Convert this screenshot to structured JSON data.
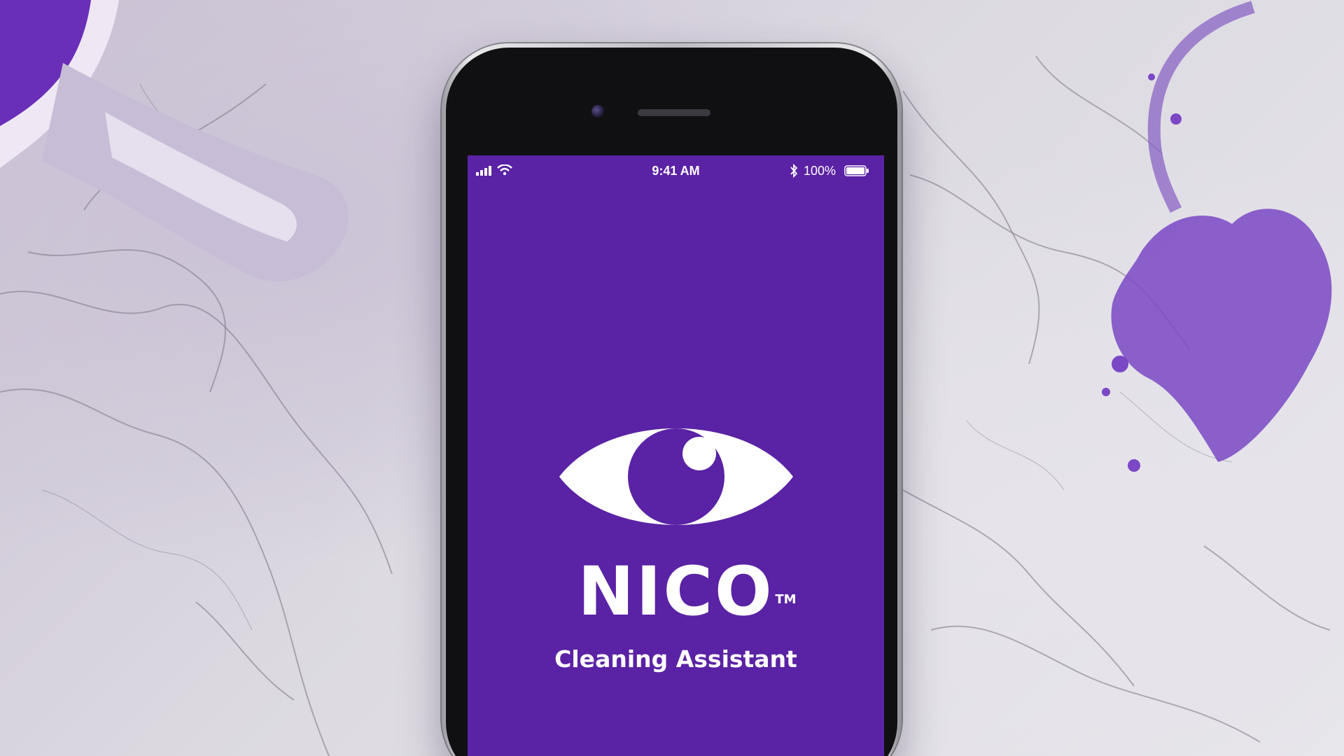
{
  "status_bar": {
    "time": "9:41 AM",
    "battery_percent": "100%",
    "signal_icon": "signal-bars-icon",
    "wifi_icon": "wifi-icon",
    "bluetooth_icon": "bluetooth-icon",
    "battery_icon": "battery-icon"
  },
  "app": {
    "logo_icon": "eye-icon",
    "name": "NICO",
    "trademark": "TM",
    "tagline": "Cleaning Assistant"
  },
  "colors": {
    "screen_background": "#5a22a4",
    "text": "#ffffff",
    "accent_purple": "#6a2fb8"
  }
}
